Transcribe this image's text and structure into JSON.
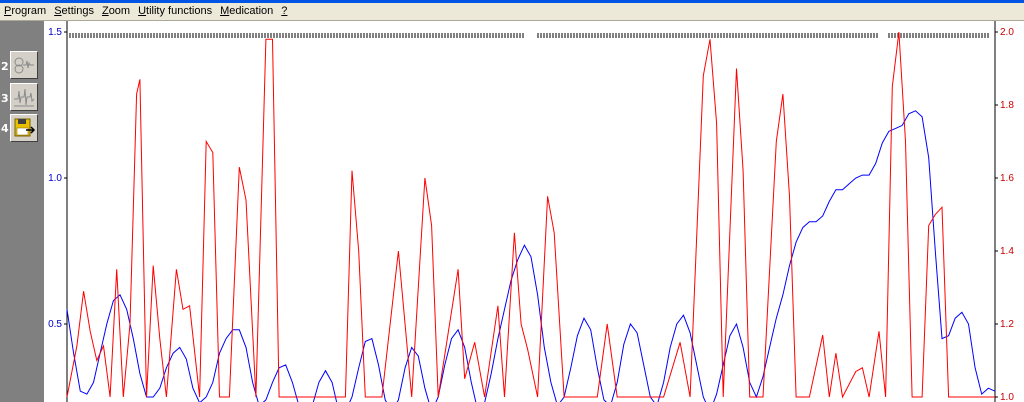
{
  "menu": {
    "items": [
      {
        "mnemonic": "P",
        "rest": "rogram"
      },
      {
        "mnemonic": "S",
        "rest": "ettings"
      },
      {
        "mnemonic": "Z",
        "rest": "oom"
      },
      {
        "mnemonic": "U",
        "rest": "tility functions"
      },
      {
        "mnemonic": "M",
        "rest": "edication"
      },
      {
        "mnemonic": "?",
        "rest": ""
      }
    ]
  },
  "toolbar": {
    "buttons": [
      {
        "number": "2",
        "icon": "signal-overview-icon"
      },
      {
        "number": "3",
        "icon": "signal-detail-icon"
      },
      {
        "number": "4",
        "icon": "save-export-icon"
      }
    ]
  },
  "colors": {
    "left_axis": "#0000cc",
    "right_axis": "#cc0000",
    "blue_series": "#0000ff",
    "red_series": "#ff0000",
    "menubar_bg": "#ece9d8"
  },
  "chart_data": {
    "type": "line",
    "left_axis": {
      "ticks": [
        "1.5",
        "1.0",
        "0.5"
      ],
      "tick_values": [
        1.5,
        1.0,
        0.5
      ],
      "range": [
        0.25,
        1.5
      ]
    },
    "right_axis": {
      "ticks": [
        "2.0",
        "1.8",
        "1.6",
        "1.4",
        "1.2",
        "1.0"
      ],
      "tick_values": [
        2.0,
        1.8,
        1.6,
        1.4,
        1.2,
        1.0
      ],
      "range": [
        0.98,
        2.0
      ]
    },
    "series": [
      {
        "axis": "left",
        "color": "#0000ff",
        "points": [
          [
            0,
            0.55
          ],
          [
            2,
            0.4
          ],
          [
            4,
            0.27
          ],
          [
            6,
            0.26
          ],
          [
            8,
            0.3
          ],
          [
            10,
            0.4
          ],
          [
            12,
            0.5
          ],
          [
            14,
            0.58
          ],
          [
            16,
            0.6
          ],
          [
            18,
            0.55
          ],
          [
            20,
            0.45
          ],
          [
            22,
            0.33
          ],
          [
            24,
            0.25
          ],
          [
            26,
            0.25
          ],
          [
            28,
            0.28
          ],
          [
            30,
            0.35
          ],
          [
            32,
            0.4
          ],
          [
            34,
            0.42
          ],
          [
            36,
            0.38
          ],
          [
            38,
            0.28
          ],
          [
            40,
            0.23
          ],
          [
            42,
            0.25
          ],
          [
            44,
            0.3
          ],
          [
            46,
            0.4
          ],
          [
            48,
            0.45
          ],
          [
            50,
            0.48
          ],
          [
            52,
            0.48
          ],
          [
            54,
            0.42
          ],
          [
            56,
            0.3
          ],
          [
            58,
            0.22
          ],
          [
            60,
            0.24
          ],
          [
            62,
            0.3
          ],
          [
            64,
            0.35
          ],
          [
            66,
            0.36
          ],
          [
            68,
            0.3
          ],
          [
            70,
            0.22
          ],
          [
            72,
            0.2
          ],
          [
            74,
            0.22
          ],
          [
            76,
            0.3
          ],
          [
            78,
            0.34
          ],
          [
            80,
            0.3
          ],
          [
            82,
            0.2
          ],
          [
            84,
            0.2
          ],
          [
            86,
            0.25
          ],
          [
            88,
            0.35
          ],
          [
            90,
            0.44
          ],
          [
            92,
            0.45
          ],
          [
            94,
            0.36
          ],
          [
            96,
            0.24
          ],
          [
            98,
            0.2
          ],
          [
            100,
            0.24
          ],
          [
            102,
            0.35
          ],
          [
            104,
            0.42
          ],
          [
            106,
            0.39
          ],
          [
            108,
            0.28
          ],
          [
            110,
            0.2
          ],
          [
            112,
            0.25
          ],
          [
            114,
            0.36
          ],
          [
            116,
            0.45
          ],
          [
            118,
            0.48
          ],
          [
            120,
            0.42
          ],
          [
            122,
            0.3
          ],
          [
            124,
            0.2
          ],
          [
            126,
            0.23
          ],
          [
            128,
            0.33
          ],
          [
            130,
            0.45
          ],
          [
            132,
            0.55
          ],
          [
            134,
            0.65
          ],
          [
            136,
            0.72
          ],
          [
            138,
            0.77
          ],
          [
            140,
            0.73
          ],
          [
            142,
            0.6
          ],
          [
            144,
            0.42
          ],
          [
            146,
            0.3
          ],
          [
            148,
            0.22
          ],
          [
            150,
            0.25
          ],
          [
            152,
            0.35
          ],
          [
            154,
            0.46
          ],
          [
            156,
            0.52
          ],
          [
            158,
            0.48
          ],
          [
            160,
            0.35
          ],
          [
            162,
            0.24
          ],
          [
            164,
            0.22
          ],
          [
            166,
            0.3
          ],
          [
            168,
            0.43
          ],
          [
            170,
            0.5
          ],
          [
            172,
            0.47
          ],
          [
            174,
            0.36
          ],
          [
            176,
            0.25
          ],
          [
            178,
            0.22
          ],
          [
            180,
            0.3
          ],
          [
            182,
            0.42
          ],
          [
            184,
            0.5
          ],
          [
            186,
            0.53
          ],
          [
            188,
            0.47
          ],
          [
            190,
            0.36
          ],
          [
            192,
            0.25
          ],
          [
            194,
            0.2
          ],
          [
            196,
            0.26
          ],
          [
            198,
            0.36
          ],
          [
            200,
            0.46
          ],
          [
            202,
            0.5
          ],
          [
            204,
            0.42
          ],
          [
            206,
            0.3
          ],
          [
            208,
            0.25
          ],
          [
            210,
            0.32
          ],
          [
            212,
            0.42
          ],
          [
            214,
            0.52
          ],
          [
            216,
            0.6
          ],
          [
            218,
            0.7
          ],
          [
            220,
            0.78
          ],
          [
            222,
            0.83
          ],
          [
            224,
            0.85
          ],
          [
            226,
            0.85
          ],
          [
            228,
            0.87
          ],
          [
            230,
            0.92
          ],
          [
            232,
            0.96
          ],
          [
            234,
            0.96
          ],
          [
            236,
            0.98
          ],
          [
            238,
            1.0
          ],
          [
            240,
            1.01
          ],
          [
            242,
            1.01
          ],
          [
            244,
            1.05
          ],
          [
            246,
            1.12
          ],
          [
            248,
            1.16
          ],
          [
            250,
            1.17
          ],
          [
            252,
            1.18
          ],
          [
            254,
            1.22
          ],
          [
            256,
            1.23
          ],
          [
            258,
            1.21
          ],
          [
            260,
            1.07
          ],
          [
            262,
            0.75
          ],
          [
            264,
            0.45
          ],
          [
            266,
            0.46
          ],
          [
            268,
            0.52
          ],
          [
            270,
            0.54
          ],
          [
            272,
            0.5
          ],
          [
            274,
            0.35
          ],
          [
            276,
            0.26
          ],
          [
            278,
            0.28
          ],
          [
            280,
            0.27
          ]
        ]
      },
      {
        "axis": "right",
        "color": "#ff0000",
        "points": [
          [
            0,
            1.0
          ],
          [
            3,
            1.14
          ],
          [
            5,
            1.29
          ],
          [
            7,
            1.18
          ],
          [
            9,
            1.1
          ],
          [
            11,
            1.14
          ],
          [
            13,
            1.0
          ],
          [
            15,
            1.35
          ],
          [
            17,
            1.0
          ],
          [
            19,
            1.2
          ],
          [
            21,
            1.83
          ],
          [
            22,
            1.87
          ],
          [
            24,
            1.0
          ],
          [
            26,
            1.36
          ],
          [
            28,
            1.16
          ],
          [
            30,
            1.0
          ],
          [
            33,
            1.35
          ],
          [
            35,
            1.24
          ],
          [
            37,
            1.25
          ],
          [
            40,
            1.0
          ],
          [
            42,
            1.7
          ],
          [
            44,
            1.67
          ],
          [
            46,
            1.0
          ],
          [
            49,
            1.0
          ],
          [
            52,
            1.63
          ],
          [
            54,
            1.54
          ],
          [
            57,
            1.0
          ],
          [
            60,
            1.98
          ],
          [
            62,
            1.98
          ],
          [
            64,
            1.0
          ],
          [
            68,
            1.0
          ],
          [
            72,
            1.0
          ],
          [
            76,
            1.0
          ],
          [
            80,
            1.0
          ],
          [
            84,
            1.0
          ],
          [
            86,
            1.62
          ],
          [
            88,
            1.4
          ],
          [
            90,
            1.0
          ],
          [
            95,
            1.0
          ],
          [
            100,
            1.4
          ],
          [
            104,
            1.0
          ],
          [
            108,
            1.6
          ],
          [
            110,
            1.47
          ],
          [
            112,
            1.0
          ],
          [
            118,
            1.35
          ],
          [
            120,
            1.05
          ],
          [
            123,
            1.15
          ],
          [
            126,
            1.0
          ],
          [
            130,
            1.25
          ],
          [
            132,
            1.0
          ],
          [
            135,
            1.45
          ],
          [
            137,
            1.2
          ],
          [
            139,
            1.13
          ],
          [
            142,
            1.0
          ],
          [
            145,
            1.55
          ],
          [
            147,
            1.45
          ],
          [
            150,
            1.0
          ],
          [
            155,
            1.0
          ],
          [
            160,
            1.0
          ],
          [
            163,
            1.2
          ],
          [
            166,
            1.0
          ],
          [
            170,
            1.0
          ],
          [
            175,
            1.0
          ],
          [
            180,
            1.0
          ],
          [
            185,
            1.15
          ],
          [
            188,
            1.0
          ],
          [
            192,
            1.88
          ],
          [
            194,
            1.98
          ],
          [
            196,
            1.75
          ],
          [
            198,
            1.0
          ],
          [
            202,
            1.9
          ],
          [
            204,
            1.62
          ],
          [
            206,
            1.0
          ],
          [
            210,
            1.0
          ],
          [
            214,
            1.7
          ],
          [
            216,
            1.83
          ],
          [
            218,
            1.55
          ],
          [
            220,
            1.0
          ],
          [
            224,
            1.0
          ],
          [
            228,
            1.17
          ],
          [
            230,
            1.0
          ],
          [
            232,
            1.12
          ],
          [
            234,
            1.0
          ],
          [
            238,
            1.07
          ],
          [
            240,
            1.08
          ],
          [
            242,
            1.0
          ],
          [
            245,
            1.18
          ],
          [
            247,
            1.0
          ],
          [
            249,
            1.85
          ],
          [
            251,
            2.0
          ],
          [
            253,
            1.7
          ],
          [
            255,
            1.0
          ],
          [
            258,
            1.0
          ],
          [
            260,
            1.47
          ],
          [
            262,
            1.5
          ],
          [
            264,
            1.52
          ],
          [
            266,
            1.0
          ],
          [
            270,
            1.0
          ],
          [
            272,
            1.0
          ],
          [
            274,
            1.0
          ],
          [
            276,
            1.0
          ],
          [
            280,
            1.0
          ]
        ]
      }
    ],
    "x_range": [
      0,
      280
    ],
    "grid": false,
    "legend": "none"
  }
}
